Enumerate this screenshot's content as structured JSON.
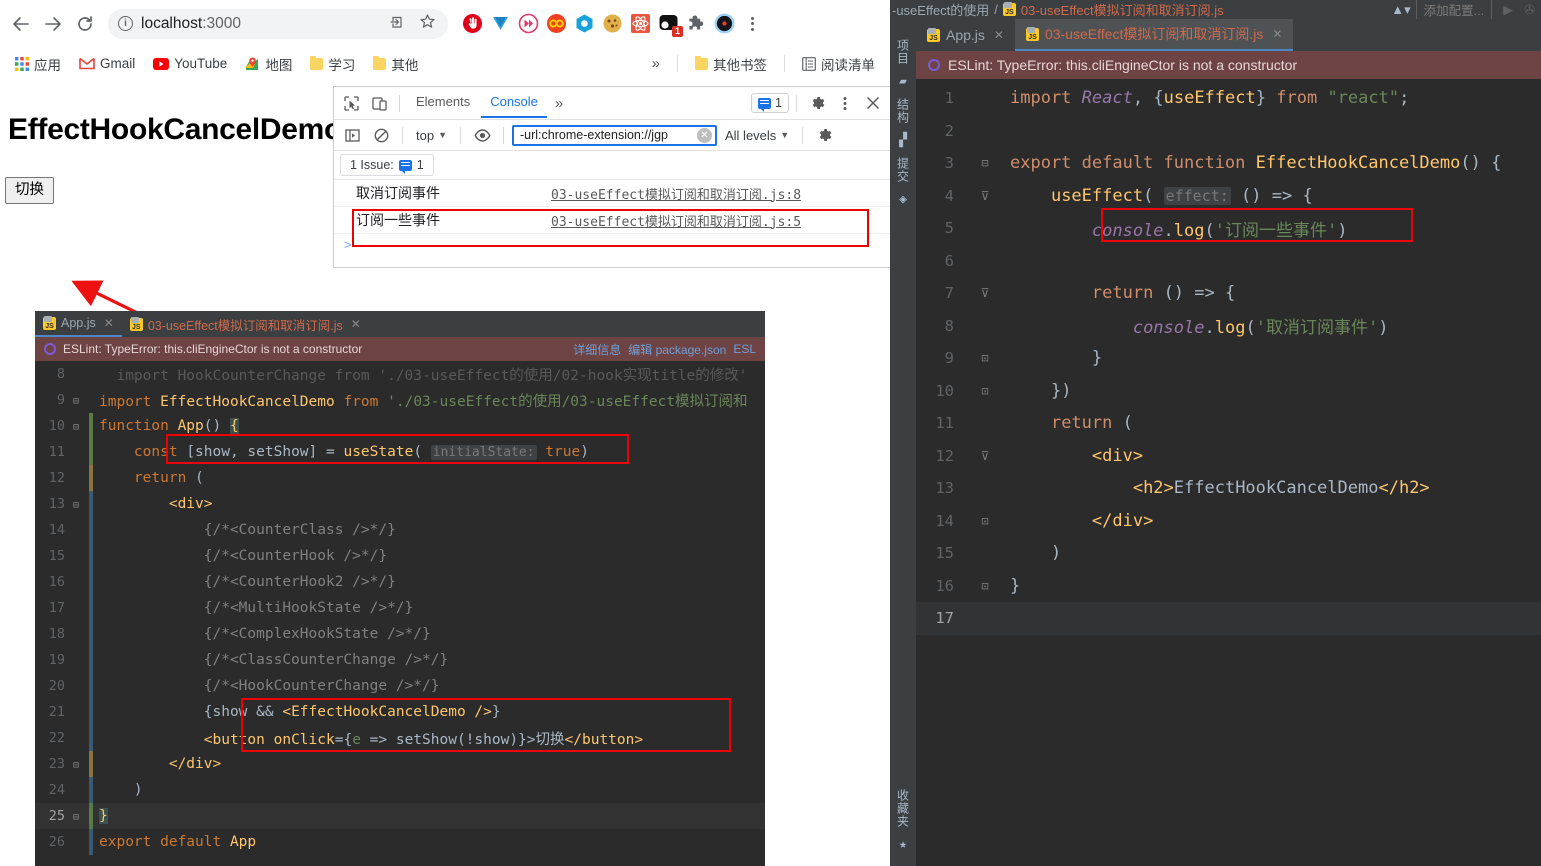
{
  "browser": {
    "nav": {
      "back": "←",
      "forward": "→",
      "reload": "⟳"
    },
    "url": {
      "host": "localhost",
      "port": ":3000",
      "info_icon": "info-icon",
      "share_icon": "⇪",
      "star_icon": "☆"
    },
    "extensions": [
      {
        "name": "adblock-extension"
      },
      {
        "name": "vimium-extension"
      },
      {
        "name": "video-speed-controller-extension"
      },
      {
        "name": "infinity-extension"
      },
      {
        "name": "octotree-extension"
      },
      {
        "name": "cookie-editor-extension"
      },
      {
        "name": "react-devtools-extension"
      },
      {
        "name": "tampermonkey-extension",
        "badge": "1"
      },
      {
        "name": "puzzle-extensions-icon"
      },
      {
        "name": "profile-avatar"
      }
    ],
    "bookmarks": [
      {
        "label": "应用",
        "icon": "apps-grid-icon"
      },
      {
        "label": "Gmail",
        "icon": "gmail-icon"
      },
      {
        "label": "YouTube",
        "icon": "youtube-icon"
      },
      {
        "label": "地图",
        "icon": "maps-icon"
      },
      {
        "label": "学习",
        "icon": "folder-icon"
      },
      {
        "label": "其他",
        "icon": "folder-icon"
      }
    ],
    "bookmarks_overflow": "»",
    "other_bookmarks": "其他书签",
    "reading_list": "阅读清单"
  },
  "page": {
    "heading": "EffectHookCancelDemo",
    "toggle_button": "切换"
  },
  "devtools": {
    "tabs": [
      {
        "label": "Elements",
        "active": false
      },
      {
        "label": "Console",
        "active": true
      }
    ],
    "more_tabs": "»",
    "issues_count": "1",
    "context": "top",
    "filter_value": "-url:chrome-extension://jgp",
    "levels": "All levels",
    "issue_bar": "1 Issue:",
    "issue_bar_count": "1",
    "logs": [
      {
        "message": "取消订阅事件",
        "source": "03-useEffect模拟订阅和取消订阅.js:8",
        "highlighted": false
      },
      {
        "message": "订阅一些事件",
        "source": "03-useEffect模拟订阅和取消订阅.js:5",
        "highlighted": true
      }
    ],
    "prompt": ">"
  },
  "ide_embed": {
    "tabs": [
      {
        "label": "App.js",
        "active": true
      },
      {
        "label": "03-useEffect模拟订阅和取消订阅.js",
        "active": false
      }
    ],
    "eslint_message": "ESLint: TypeError: this.cliEngineCtor is not a constructor",
    "eslint_links": [
      "详细信息",
      "编辑 package.json",
      "ESL"
    ],
    "lines": [
      {
        "n": "8",
        "text": "    import HookCounterChange from './03-useEffect的使用/02-hook实现title的修改'"
      },
      {
        "n": "9",
        "text": "import EffectHookCancelDemo from './03-useEffect的使用/03-useEffect模拟订阅和"
      },
      {
        "n": "10",
        "text": "function App() {"
      },
      {
        "n": "11",
        "text": "    const [show, setShow] = useState( initialState: true)"
      },
      {
        "n": "12",
        "text": "    return ("
      },
      {
        "n": "13",
        "text": "        <div>"
      },
      {
        "n": "14",
        "text": "            {/*<CounterClass />*/}"
      },
      {
        "n": "15",
        "text": "            {/*<CounterHook />*/}"
      },
      {
        "n": "16",
        "text": "            {/*<CounterHook2 />*/}"
      },
      {
        "n": "17",
        "text": "            {/*<MultiHookState />*/}"
      },
      {
        "n": "18",
        "text": "            {/*<ComplexHookState />*/}"
      },
      {
        "n": "19",
        "text": "            {/*<ClassCounterChange />*/}"
      },
      {
        "n": "20",
        "text": "            {/*<HookCounterChange />*/}"
      },
      {
        "n": "21",
        "text": "            {show && <EffectHookCancelDemo />}"
      },
      {
        "n": "22",
        "text": "            <button onClick={e => setShow(!show)}>切换</button>"
      },
      {
        "n": "23",
        "text": "        </div>"
      },
      {
        "n": "24",
        "text": "    )"
      },
      {
        "n": "25",
        "text": "}"
      },
      {
        "n": "26",
        "text": "export default App"
      }
    ]
  },
  "ide_right": {
    "breadcrumb_dim": "-useEffect的使用",
    "breadcrumb_sep": "/",
    "breadcrumb_file": "03-useEffect模拟订阅和取消订阅.js",
    "run_config": "添加配置...",
    "rail_items": [
      {
        "label": "项目",
        "icon": "project-icon"
      },
      {
        "label": "结构",
        "icon": "structure-icon"
      },
      {
        "label": "提交",
        "icon": "commit-icon"
      }
    ],
    "rail_bottom": {
      "label": "收藏夹",
      "icon": "star-icon"
    },
    "tabs": [
      {
        "label": "App.js",
        "active": false
      },
      {
        "label": "03-useEffect模拟订阅和取消订阅.js",
        "active": true
      }
    ],
    "eslint_message": "ESLint: TypeError: this.cliEngineCtor is not a constructor",
    "lines": [
      {
        "n": "1",
        "text": "import React, {useEffect} from \"react\";"
      },
      {
        "n": "2",
        "text": ""
      },
      {
        "n": "3",
        "text": "export default function EffectHookCancelDemo() {"
      },
      {
        "n": "4",
        "text": "    useEffect( effect: () => {"
      },
      {
        "n": "5",
        "text": "        console.log('订阅一些事件')"
      },
      {
        "n": "6",
        "text": ""
      },
      {
        "n": "7",
        "text": "        return () => {"
      },
      {
        "n": "8",
        "text": "            console.log('取消订阅事件')"
      },
      {
        "n": "9",
        "text": "        }"
      },
      {
        "n": "10",
        "text": "    })"
      },
      {
        "n": "11",
        "text": "    return ("
      },
      {
        "n": "12",
        "text": "        <div>"
      },
      {
        "n": "13",
        "text": "            <h2>EffectHookCancelDemo</h2>"
      },
      {
        "n": "14",
        "text": "        </div>"
      },
      {
        "n": "15",
        "text": "    )"
      },
      {
        "n": "16",
        "text": "}"
      },
      {
        "n": "17",
        "text": ""
      }
    ]
  },
  "annotations": {
    "arrow_color": "#ee1111",
    "box_color": "#ee0000"
  }
}
